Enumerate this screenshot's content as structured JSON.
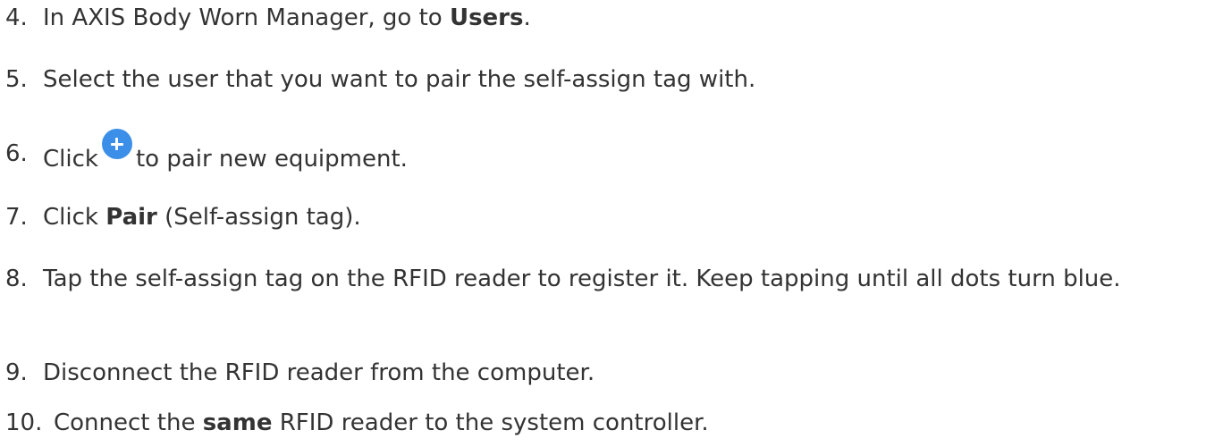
{
  "steps": [
    {
      "number": "4.",
      "before": "In AXIS Body Worn Manager, go to ",
      "bold": "Users",
      "after": "."
    },
    {
      "number": "5.",
      "text": "Select the user that you want to pair the self-assign tag with."
    },
    {
      "number": "6.",
      "before": "Click",
      "icon": "plus-icon",
      "after": "to pair new equipment."
    },
    {
      "number": "7.",
      "before": "Click ",
      "bold": "Pair",
      "after": " (Self-assign tag)."
    },
    {
      "number": "8.",
      "text": "Tap the self-assign tag on the RFID reader to register it. Keep tapping until all dots turn blue."
    },
    {
      "number": "9.",
      "text": "Disconnect the RFID reader from the computer."
    },
    {
      "number": "10.",
      "before": "Connect the ",
      "bold": "same",
      "after": " RFID reader to the system controller."
    }
  ],
  "colors": {
    "text": "#333333",
    "icon_bg": "#3b8fe8"
  }
}
